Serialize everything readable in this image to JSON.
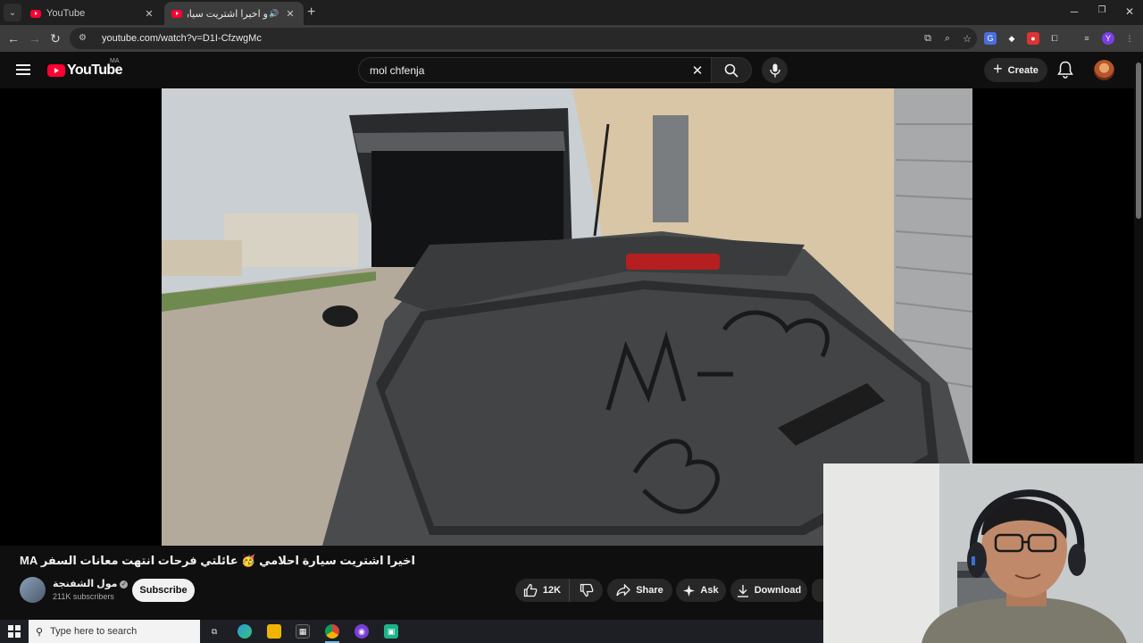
{
  "browser": {
    "tabs": [
      {
        "title": "YouTube",
        "active": false
      },
      {
        "title": "و اخيرا اشتريت سيارة احلامي",
        "active": true
      }
    ],
    "url": "youtube.com/watch?v=D1I-CfzwgMc"
  },
  "youtube": {
    "logo_text": "YouTube",
    "country_code": "MA",
    "search_query": "mol chfenja",
    "create_label": "Create"
  },
  "video": {
    "title": "اخيرا اشتريت سيارة احلامي 🥳 عائلتي فرحات انتهت معانات السفر MA",
    "channel_name": "مول الشفنجة",
    "subscribers": "211K subscribers",
    "subscribe_label": "Subscribe",
    "likes": "12K",
    "share_label": "Share",
    "ask_label": "Ask",
    "download_label": "Download"
  },
  "taskbar": {
    "search_placeholder": "Type here to search"
  },
  "colors": {
    "yt_red": "#ff0033",
    "bg": "#0f0f0f",
    "pill": "#272727"
  }
}
